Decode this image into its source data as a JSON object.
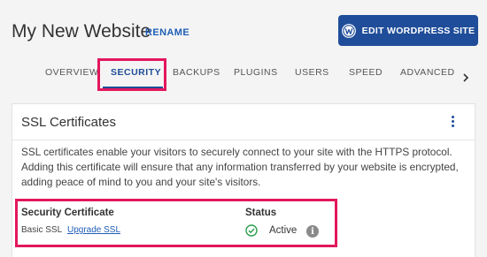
{
  "header": {
    "title": "My New Website",
    "rename_label": "RENAME",
    "edit_button_label": "EDIT WORDPRESS SITE",
    "edit_button_icon": "wordpress-icon"
  },
  "tabs": {
    "items": [
      {
        "label": "OVERVIEW"
      },
      {
        "label": "SECURITY",
        "active": true
      },
      {
        "label": "BACKUPS"
      },
      {
        "label": "PLUGINS"
      },
      {
        "label": "USERS"
      },
      {
        "label": "SPEED"
      },
      {
        "label": "ADVANCED"
      }
    ],
    "more_icon": "chevron-right-icon"
  },
  "card": {
    "title": "SSL Certificates",
    "menu_icon": "kebab-menu-icon",
    "description": "SSL certificates enable your visitors to securely connect to your site with the HTTPS protocol. Adding this certificate will ensure that any information transferred by your website is encrypted, adding peace of mind to you and your site's visitors.",
    "certificate": {
      "header": "Security Certificate",
      "type": "Basic SSL",
      "upgrade_label": "Upgrade SSL"
    },
    "status": {
      "header": "Status",
      "value": "Active",
      "status_icon": "check-circle-icon",
      "info_icon": "info-icon"
    }
  },
  "colors": {
    "primary": "#1f4d99",
    "link": "#1f5eb5",
    "highlight": "#e3175d",
    "success": "#2e9e4f"
  }
}
